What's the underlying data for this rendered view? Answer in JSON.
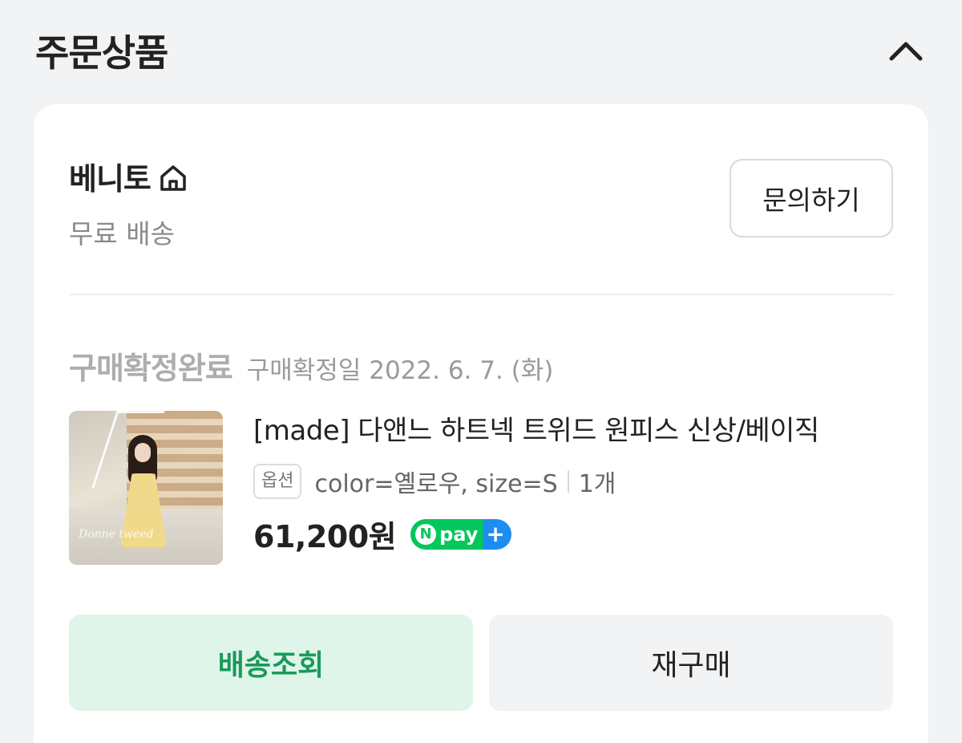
{
  "section": {
    "title": "주문상품",
    "collapse_icon": "chevron-up-icon"
  },
  "store": {
    "name": "베니토",
    "home_icon": "home-icon",
    "shipping": "무료 배송",
    "inquiry_label": "문의하기"
  },
  "order": {
    "status": "구매확정완료",
    "status_date": "구매확정일 2022. 6. 7. (화)"
  },
  "product": {
    "name": "[made] 다앤느 하트넥 트위드 원피스 신상/베이직",
    "thumbnail_watermark": "Donne tweed",
    "option_badge": "옵션",
    "option_text": "color=옐로우, size=S",
    "quantity": "1개",
    "price": "61,200원",
    "npay_label": "pay"
  },
  "actions": {
    "track_label": "배송조회",
    "rebuy_label": "재구매"
  },
  "colors": {
    "background": "#f1f3f5",
    "card": "#ffffff",
    "accent_green": "#03c75a",
    "track_bg": "#dff5ea",
    "track_text": "#1a9a5a",
    "npay_blue": "#1e8cf0"
  }
}
